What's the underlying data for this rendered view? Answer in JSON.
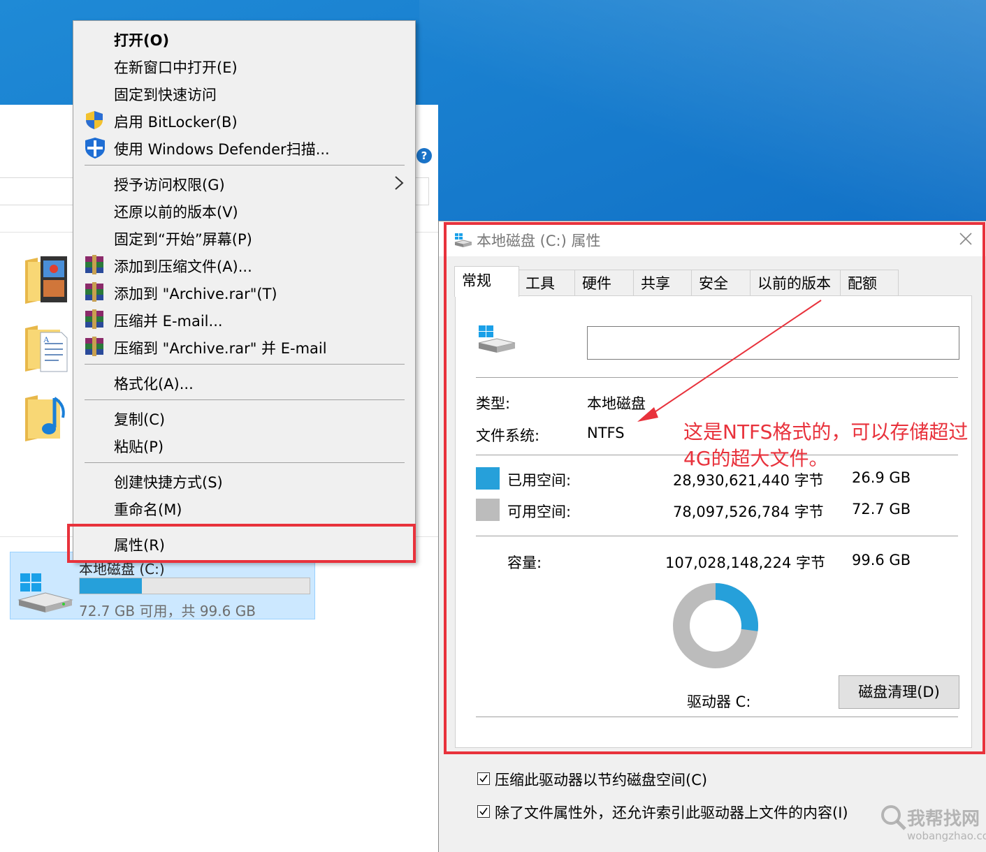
{
  "context_menu": {
    "items": [
      {
        "label": "打开(O)"
      },
      {
        "label": "在新窗口中打开(E)"
      },
      {
        "label": "固定到快速访问"
      },
      {
        "label": "启用 BitLocker(B)"
      },
      {
        "label": "使用 Windows Defender扫描..."
      },
      {
        "label": "授予访问权限(G)"
      },
      {
        "label": "还原以前的版本(V)"
      },
      {
        "label": "固定到“开始”屏幕(P)"
      },
      {
        "label": "添加到压缩文件(A)..."
      },
      {
        "label": "添加到 \"Archive.rar\"(T)"
      },
      {
        "label": "压缩并 E-mail..."
      },
      {
        "label": "压缩到 \"Archive.rar\" 并 E-mail"
      },
      {
        "label": "格式化(A)..."
      },
      {
        "label": "复制(C)"
      },
      {
        "label": "粘贴(P)"
      },
      {
        "label": "创建快捷方式(S)"
      },
      {
        "label": "重命名(M)"
      },
      {
        "label": "属性(R)"
      }
    ]
  },
  "drive_tile": {
    "name": "本地磁盘 (C:)",
    "free_text": "72.7 GB 可用，共 99.6 GB",
    "used_fraction": 0.27
  },
  "properties": {
    "title": "本地磁盘 (C:) 属性",
    "tabs": [
      {
        "label": "常规"
      },
      {
        "label": "工具"
      },
      {
        "label": "硬件"
      },
      {
        "label": "共享"
      },
      {
        "label": "安全"
      },
      {
        "label": "以前的版本"
      },
      {
        "label": "配额"
      }
    ],
    "name_value": "",
    "type_label": "类型:",
    "type_value": "本地磁盘",
    "fs_label": "文件系统:",
    "fs_value": "NTFS",
    "used_label": "已用空间:",
    "used_bytes": "28,930,621,440 字节",
    "used_gb": "26.9 GB",
    "free_label": "可用空间:",
    "free_bytes": "78,097,526,784 字节",
    "free_gb": "72.7 GB",
    "capacity_label": "容量:",
    "capacity_bytes": "107,028,148,224 字节",
    "capacity_gb": "99.6 GB",
    "drive_label": "驱动器 C:",
    "cleanup_button": "磁盘清理(D)",
    "compress_option": "压缩此驱动器以节约磁盘空间(C)",
    "index_option": "除了文件属性外，还允许索引此驱动器上文件的内容(I)",
    "used_fraction": 0.2703,
    "colors": {
      "used": "#26a0da",
      "free": "#bcbcbc"
    }
  },
  "annotation": {
    "line1": "这是NTFS格式的，可以存储超过",
    "line2": "4G的超大文件。",
    "color": "#e8323c"
  },
  "watermark": {
    "text": "我帮找网",
    "url": "wobangzhao.com"
  }
}
